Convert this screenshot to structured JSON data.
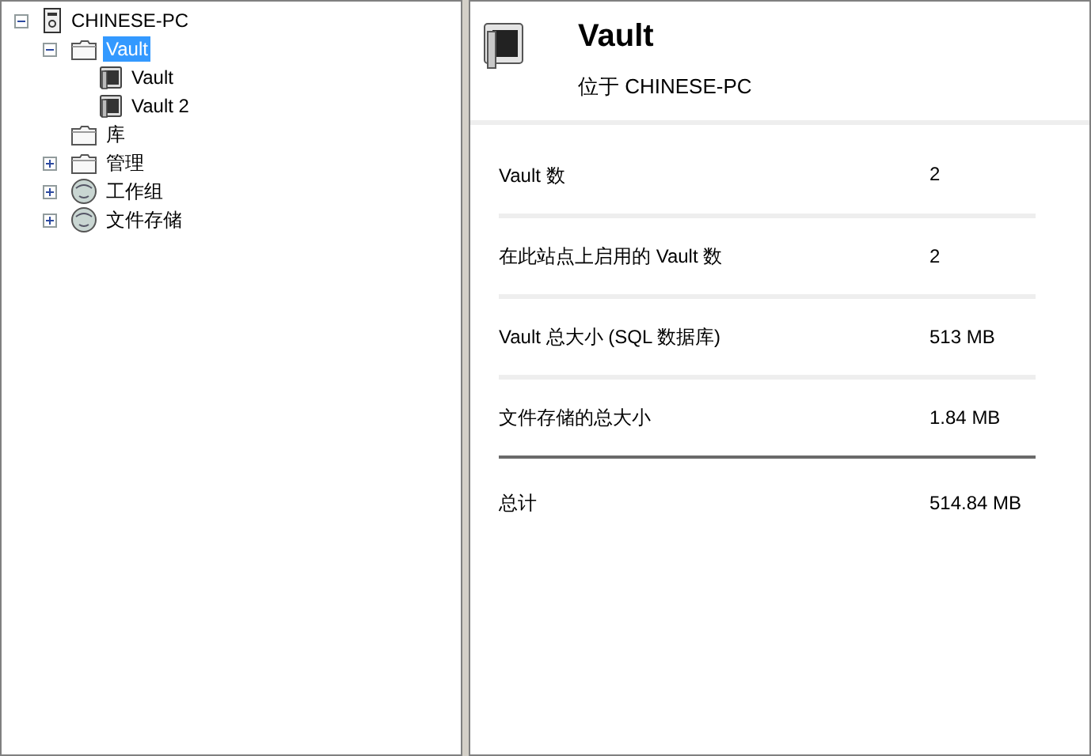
{
  "tree": [
    {
      "label": "CHINESE-PC",
      "kind": "computer",
      "expanded": true,
      "selected": false,
      "children": [
        {
          "label": "Vault",
          "kind": "folder",
          "expanded": true,
          "selected": true,
          "children": [
            {
              "label": "Vault",
              "kind": "vault",
              "selected": false
            },
            {
              "label": "Vault 2",
              "kind": "vault",
              "selected": false
            }
          ]
        },
        {
          "label": "库",
          "kind": "folder",
          "selected": false
        },
        {
          "label": "管理",
          "kind": "folder",
          "expanded": false,
          "selected": false
        },
        {
          "label": "工作组",
          "kind": "globe",
          "expanded": false,
          "selected": false
        },
        {
          "label": "文件存储",
          "kind": "globe",
          "expanded": false,
          "selected": false
        }
      ]
    }
  ],
  "details": {
    "title": "Vault",
    "subtitle": "位于 CHINESE-PC",
    "rows": [
      {
        "label": "Vault 数",
        "value": "2"
      },
      {
        "label": "在此站点上启用的 Vault 数",
        "value": "2"
      },
      {
        "label": "Vault 总大小 (SQL 数据库)",
        "value": "513 MB"
      },
      {
        "label": "文件存储的总大小",
        "value": "1.84 MB"
      }
    ],
    "total": {
      "label": "总计",
      "value": "514.84 MB"
    }
  }
}
